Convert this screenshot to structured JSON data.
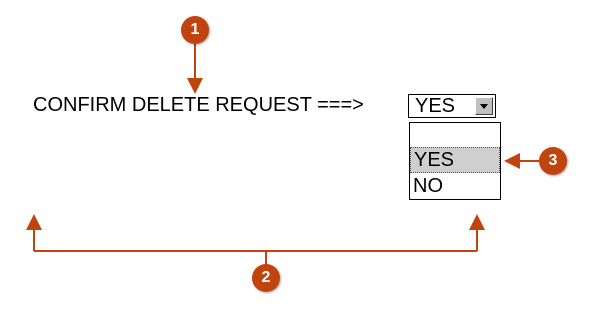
{
  "confirm_label": "CONFIRM DELETE REQUEST ===>",
  "select": {
    "value": "YES",
    "options": [
      "",
      "YES",
      "NO"
    ],
    "highlighted_option": "YES"
  },
  "callouts": [
    "1",
    "2",
    "3"
  ],
  "colors": {
    "callout": "#c1440e",
    "arrow": "#c1440e",
    "highlight": "#cfcfcf"
  },
  "icons": {
    "dropdown_arrow": "chevron-down-icon"
  }
}
